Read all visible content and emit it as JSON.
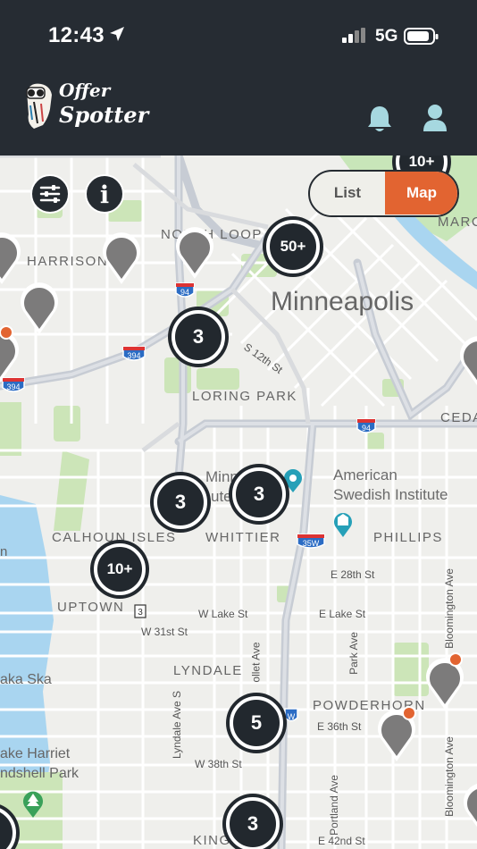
{
  "status_bar": {
    "time": "12:43",
    "network": "5G"
  },
  "app": {
    "logo_line1": "Offer",
    "logo_line2": "Spotter"
  },
  "map": {
    "toggle": {
      "list_label": "List",
      "map_label": "Map",
      "active": "Map"
    },
    "clusters": [
      {
        "count": "10+"
      },
      {
        "count": "50+"
      },
      {
        "count": "3"
      },
      {
        "count": "3"
      },
      {
        "count": "3"
      },
      {
        "count": "10+"
      },
      {
        "count": "5"
      },
      {
        "count": "3"
      }
    ],
    "labels": {
      "city": "Minneapolis",
      "loring_park": "LORING PARK",
      "harrison": "HARRISON",
      "north_loop": "NORTH LOOP",
      "marcy": "MARC",
      "cedar": "CEDA",
      "american_swedish_1": "American",
      "american_swedish_2": "Swedish Institute",
      "minnea_1": "Minnea",
      "minnea_2": "ute",
      "calhoun_isles": "CALHOUN ISLES",
      "whittier": "WHITTIER",
      "phillips": "PHILLIPS",
      "uptown": "UPTOWN",
      "lyndale": "LYNDALE",
      "powderhorn": "POWDERHORN",
      "lake_harriet_1": "ake Harriet",
      "lake_harriet_2": "ndshell Park",
      "lake_kaka": "aka Ska",
      "kingfield": "KING",
      "s12th": "S 12th St",
      "e28th": "E 28th St",
      "w_lake": "W Lake St",
      "e_lake": "E Lake St",
      "w31st": "W 31st St",
      "e36th": "E 36th St",
      "w38th": "W 38th St",
      "e42nd": "E 42nd St",
      "lyndale_ave": "Lyndale Ave S",
      "nicollet_ave": "ollet Ave",
      "park_ave": "Park Ave",
      "portland_ave": "Portland Ave",
      "bloomington_ave_1": "Bloomington Ave",
      "bloomington_ave_2": "Bloomington Ave",
      "n_lake": "n",
      "shield_94a": "94",
      "shield_94b": "94",
      "shield_394a": "394",
      "shield_394b": "394",
      "shield_35w": "35W",
      "shield_35w_b": "W",
      "shield_3": "3"
    }
  },
  "colors": {
    "accent": "#e26431",
    "dark": "#262c33",
    "pin": "#7c7b7b"
  }
}
